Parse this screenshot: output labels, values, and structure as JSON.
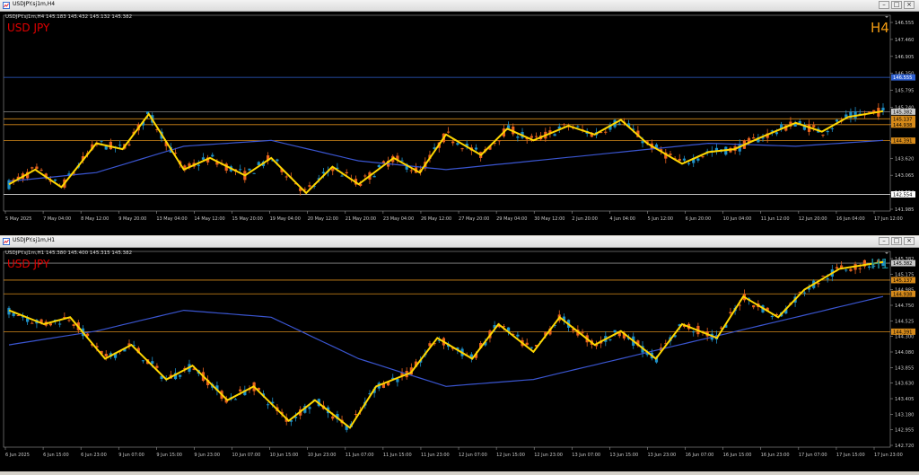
{
  "windows": [
    {
      "caption": "USDJPY.sj1m,H4",
      "timeframe": "H4",
      "ohlc": "145.183 145.432 145.132 145.382",
      "symbol_label": "USD JPY",
      "timeframe_color": "#f39c12",
      "price_ticks": [
        "146.555",
        "147.460",
        "146.905",
        "146.350",
        "145.795",
        "145.240",
        "144.730",
        "144.175",
        "143.620",
        "143.065",
        "142.554",
        "141.985"
      ],
      "price_tags": [
        "146.555",
        "145.382",
        "145.137",
        "144.938",
        "144.391",
        "142.554"
      ],
      "time_labels": [
        "5 May 2025",
        "7 May 04:00",
        "8 May 12:00",
        "9 May 20:00",
        "13 May 04:00",
        "14 May 12:00",
        "15 May 20:00",
        "19 May 04:00",
        "20 May 12:00",
        "21 May 20:00",
        "23 May 04:00",
        "26 May 12:00",
        "27 May 20:00",
        "29 May 04:00",
        "30 May 12:00",
        "2 Jun 20:00",
        "4 Jun 04:00",
        "5 Jun 12:00",
        "6 Jun 20:00",
        "10 Jun 04:00",
        "11 Jun 12:00",
        "12 Jun 20:00",
        "16 Jun 04:00",
        "17 Jun 12:00"
      ]
    },
    {
      "caption": "USDJPY.sj1m,H1",
      "timeframe": "H1",
      "ohlc": "145.380 145.400 145.315 145.382",
      "symbol_label": "USD JPY",
      "timeframe_color": "#1a8a9a",
      "price_ticks": [
        "145.382",
        "145.175",
        "144.985",
        "144.750",
        "144.525",
        "144.300",
        "144.080",
        "143.855",
        "143.630",
        "143.405",
        "143.180",
        "142.955",
        "142.720"
      ],
      "price_tags": [
        "145.382",
        "145.137",
        "144.938",
        "144.391"
      ],
      "time_labels": [
        "6 Jun 2025",
        "6 Jun 15:00",
        "6 Jun 23:00",
        "9 Jun 07:00",
        "9 Jun 15:00",
        "9 Jun 23:00",
        "10 Jun 07:00",
        "10 Jun 15:00",
        "10 Jun 23:00",
        "11 Jun 07:00",
        "11 Jun 15:00",
        "11 Jun 23:00",
        "12 Jun 07:00",
        "12 Jun 15:00",
        "12 Jun 23:00",
        "13 Jun 07:00",
        "13 Jun 15:00",
        "13 Jun 23:00",
        "16 Jun 07:00",
        "16 Jun 15:00",
        "16 Jun 23:00",
        "17 Jun 07:00",
        "17 Jun 15:00",
        "17 Jun 23:00"
      ]
    }
  ],
  "colors": {
    "bull": "#1e90c8",
    "bear": "#e8641e",
    "zigzag": "#ffd700",
    "ma": "#3a55d0",
    "level_orange": "#d68a1a",
    "level_gray": "#8a8a8a",
    "level_blue": "#2e5fd0",
    "label_red": "#e00000"
  },
  "chart_data": [
    {
      "type": "candlestick",
      "title": "USD JPY H4",
      "series": [
        {
          "name": "zigzag",
          "x_frac": [
            0.0,
            0.03,
            0.06,
            0.1,
            0.13,
            0.16,
            0.2,
            0.23,
            0.27,
            0.3,
            0.34,
            0.37,
            0.4,
            0.44,
            0.47,
            0.5,
            0.54,
            0.57,
            0.6,
            0.64,
            0.67,
            0.7,
            0.73,
            0.77,
            0.8,
            0.83,
            0.86,
            0.9,
            0.93,
            0.96,
            1.0
          ],
          "values": [
            142.9,
            143.4,
            142.8,
            144.3,
            144.1,
            145.3,
            143.4,
            143.8,
            143.2,
            143.8,
            142.6,
            143.5,
            142.9,
            143.8,
            143.3,
            144.6,
            143.9,
            144.8,
            144.4,
            144.9,
            144.6,
            145.1,
            144.3,
            143.6,
            144.0,
            144.1,
            144.5,
            145.0,
            144.7,
            145.2,
            145.4
          ]
        },
        {
          "name": "moving average",
          "x_frac": [
            0.0,
            0.1,
            0.2,
            0.3,
            0.4,
            0.5,
            0.6,
            0.7,
            0.8,
            0.9,
            1.0
          ],
          "values": [
            143.0,
            143.3,
            144.2,
            144.4,
            143.7,
            143.4,
            143.7,
            144.0,
            144.3,
            144.2,
            144.4
          ]
        }
      ],
      "horizontal_levels": [
        146.555,
        145.382,
        145.137,
        144.938,
        144.391,
        142.554
      ],
      "ylim": [
        141.985,
        148.555
      ]
    },
    {
      "type": "candlestick",
      "title": "USD JPY H1",
      "series": [
        {
          "name": "zigzag",
          "x_frac": [
            0.0,
            0.04,
            0.07,
            0.11,
            0.14,
            0.18,
            0.21,
            0.25,
            0.28,
            0.32,
            0.35,
            0.39,
            0.42,
            0.46,
            0.49,
            0.53,
            0.56,
            0.6,
            0.63,
            0.67,
            0.7,
            0.74,
            0.77,
            0.81,
            0.84,
            0.88,
            0.91,
            0.95,
            1.0
          ],
          "values": [
            144.7,
            144.5,
            144.6,
            144.0,
            144.2,
            143.7,
            143.9,
            143.4,
            143.6,
            143.1,
            143.4,
            143.0,
            143.6,
            143.8,
            144.3,
            144.0,
            144.5,
            144.1,
            144.6,
            144.2,
            144.4,
            144.0,
            144.5,
            144.3,
            144.9,
            144.6,
            145.0,
            145.3,
            145.4
          ]
        },
        {
          "name": "moving average",
          "x_frac": [
            0.0,
            0.1,
            0.2,
            0.3,
            0.4,
            0.5,
            0.6,
            0.7,
            0.8,
            0.9,
            1.0
          ],
          "values": [
            144.2,
            144.4,
            144.7,
            144.6,
            144.0,
            143.6,
            143.7,
            144.0,
            144.3,
            144.6,
            144.9
          ]
        }
      ],
      "horizontal_levels": [
        145.382,
        145.137,
        144.938,
        144.391
      ],
      "ylim": [
        142.72,
        145.5
      ]
    }
  ]
}
